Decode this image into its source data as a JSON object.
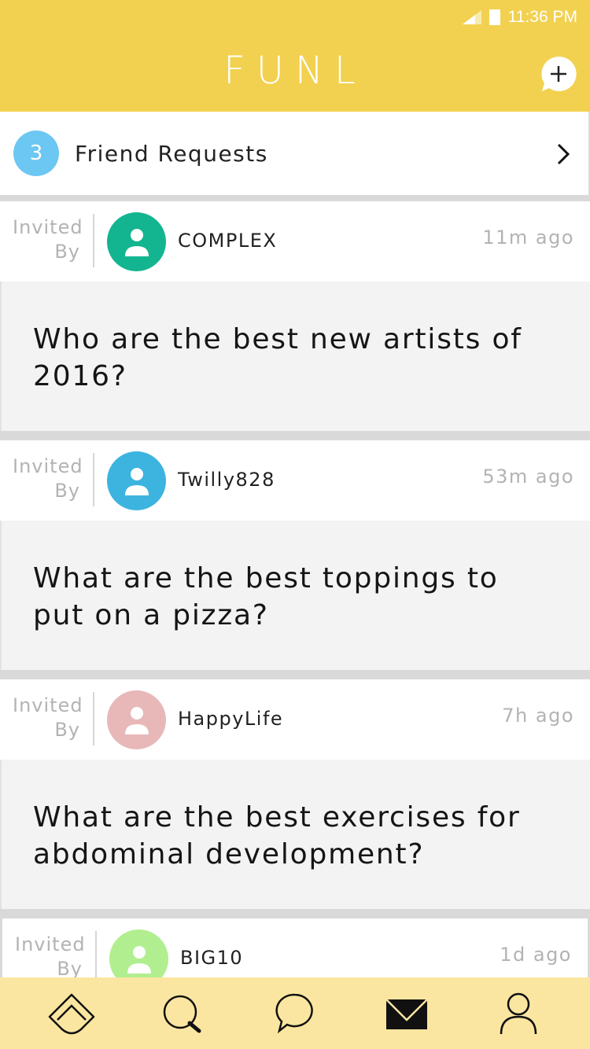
{
  "status": {
    "time": "11:36 PM"
  },
  "app": {
    "logo": "FUNL"
  },
  "friend_requests": {
    "count": "3",
    "label": "Friend Requests"
  },
  "invited_label": [
    "Invited",
    "By"
  ],
  "feed": [
    {
      "user": "COMPLEX",
      "time": "11m ago",
      "question": "Who are the best new artists of 2016?",
      "avatar_color": "#13b590"
    },
    {
      "user": "Twilly828",
      "time": "53m ago",
      "question": "What are the best toppings to put on a pizza?",
      "avatar_color": "#3db4e0"
    },
    {
      "user": "HappyLife",
      "time": "7h ago",
      "question": "What are the best exercises for abdominal development?",
      "avatar_color": "#e8b8b8"
    },
    {
      "user": "BIG10",
      "time": "1d ago",
      "question": "",
      "avatar_color": "#b1ee8f"
    }
  ],
  "nav": [
    {
      "icon": "home-icon"
    },
    {
      "icon": "search-icon"
    },
    {
      "icon": "chat-icon"
    },
    {
      "icon": "mail-icon"
    },
    {
      "icon": "profile-icon"
    }
  ],
  "colors": {
    "header": "#f2d150",
    "nav_bg": "#fbe6a1",
    "badge": "#6cc7f2"
  }
}
